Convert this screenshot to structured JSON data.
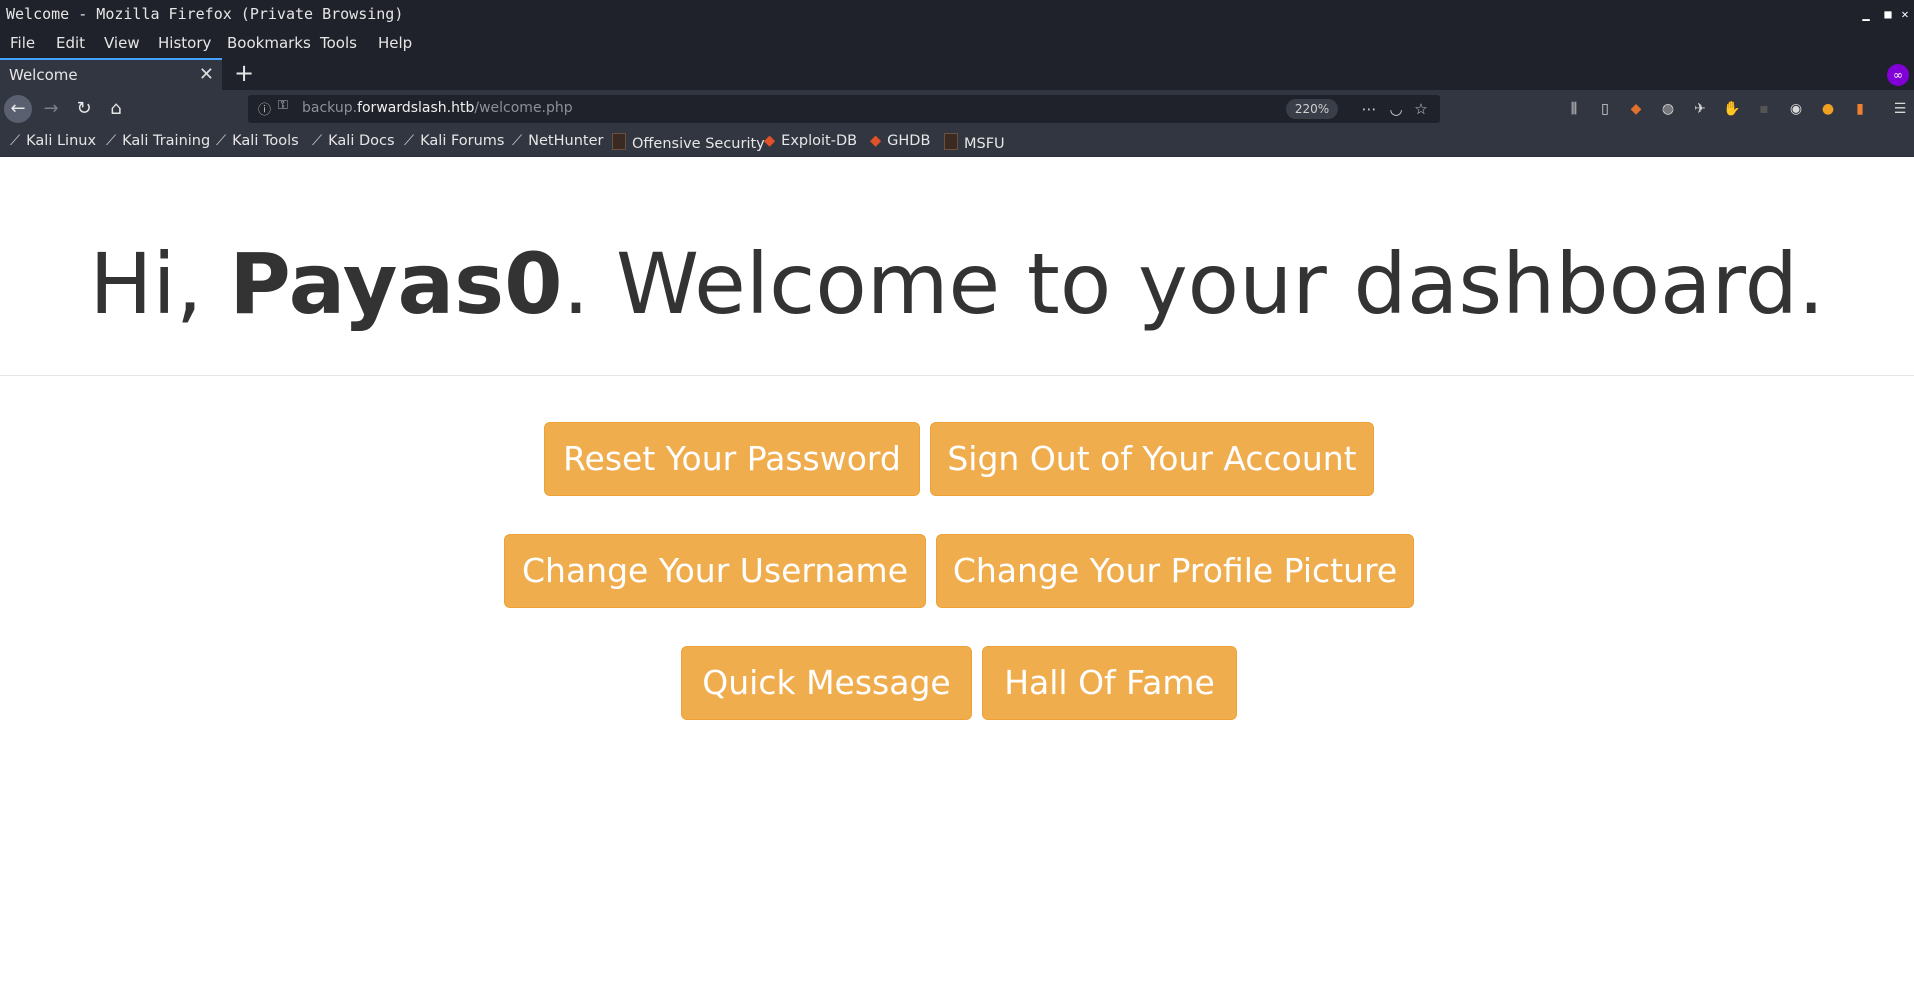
{
  "window": {
    "title": "Welcome - Mozilla Firefox (Private Browsing)"
  },
  "menu": [
    "File",
    "Edit",
    "View",
    "History",
    "Bookmarks",
    "Tools",
    "Help"
  ],
  "tab": {
    "label": "Welcome"
  },
  "urlbar": {
    "host_prefix": "backup.",
    "host": "forwardslash.htb",
    "path": "/welcome.php",
    "zoom": "220%"
  },
  "bookmarks": [
    "Kali Linux",
    "Kali Training",
    "Kali Tools",
    "Kali Docs",
    "Kali Forums",
    "NetHunter",
    "Offensive Security",
    "Exploit-DB",
    "GHDB",
    "MSFU"
  ],
  "page": {
    "greeting_prefix": "Hi, ",
    "username": "Payas0",
    "greeting_suffix": ". Welcome to your dashboard.",
    "buttons": {
      "reset_password": "Reset Your Password",
      "sign_out": "Sign Out of Your Account",
      "change_username": "Change Your Username",
      "change_picture": "Change Your Profile Picture",
      "quick_message": "Quick Message",
      "hall_of_fame": "Hall Of Fame"
    }
  },
  "colors": {
    "button_bg": "#f0ad4e",
    "chrome_dark": "#1f222b",
    "chrome_mid": "#323640",
    "private_badge": "#8000d7"
  }
}
